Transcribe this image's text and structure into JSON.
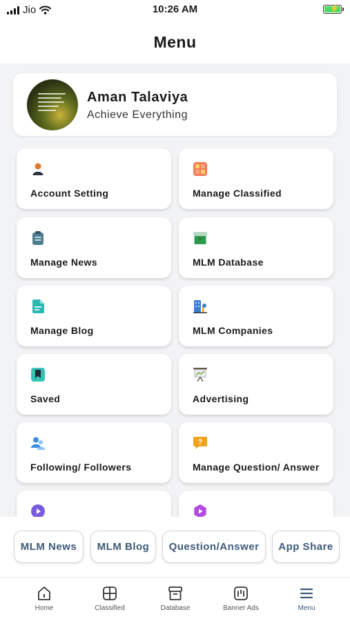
{
  "status_bar": {
    "carrier": "Jio",
    "time": "10:26 AM"
  },
  "header": {
    "title": "Menu"
  },
  "profile": {
    "name": "Aman Talaviya",
    "subtitle": "Achieve Everything"
  },
  "menu_items": [
    {
      "label": "Account Setting",
      "icon": "person-icon",
      "color": "#e07a2e"
    },
    {
      "label": "Manage Classified",
      "icon": "grid-icon",
      "color": "#f0714a"
    },
    {
      "label": "Manage News",
      "icon": "clipboard-icon",
      "color": "#4f7c8f"
    },
    {
      "label": "MLM Database",
      "icon": "archive-icon",
      "color": "#2e9a4c"
    },
    {
      "label": "Manage Blog",
      "icon": "document-icon",
      "color": "#2bb8b0"
    },
    {
      "label": "MLM Companies",
      "icon": "building-icon",
      "color": "#3b7dd8"
    },
    {
      "label": "Saved",
      "icon": "bookmark-icon",
      "color": "#34c3b5"
    },
    {
      "label": "Advertising",
      "icon": "presentation-icon",
      "color": "#8aa84a"
    },
    {
      "label": "Following/ Followers",
      "icon": "users-icon",
      "color": "#3b8ee0"
    },
    {
      "label": "Manage Question/ Answer",
      "icon": "question-bubble-icon",
      "color": "#f2a21a"
    },
    {
      "label": "",
      "icon": "play-icon",
      "color": "#7a5be0"
    },
    {
      "label": "",
      "icon": "video-icon",
      "color": "#b44be0"
    }
  ],
  "quick_links": [
    "MLM News",
    "MLM Blog",
    "Question/Answer",
    "App Share"
  ],
  "tab_bar": {
    "active": "Menu",
    "tabs": [
      {
        "label": "Home",
        "icon": "home-icon"
      },
      {
        "label": "Classified",
        "icon": "grid-icon"
      },
      {
        "label": "Database",
        "icon": "archive-icon"
      },
      {
        "label": "Banner Ads",
        "icon": "banner-icon"
      },
      {
        "label": "Menu",
        "icon": "menu-icon"
      }
    ]
  },
  "colors": {
    "accent": "#3e5a7a",
    "background": "#f2f3f5",
    "battery": "#4cd964"
  }
}
